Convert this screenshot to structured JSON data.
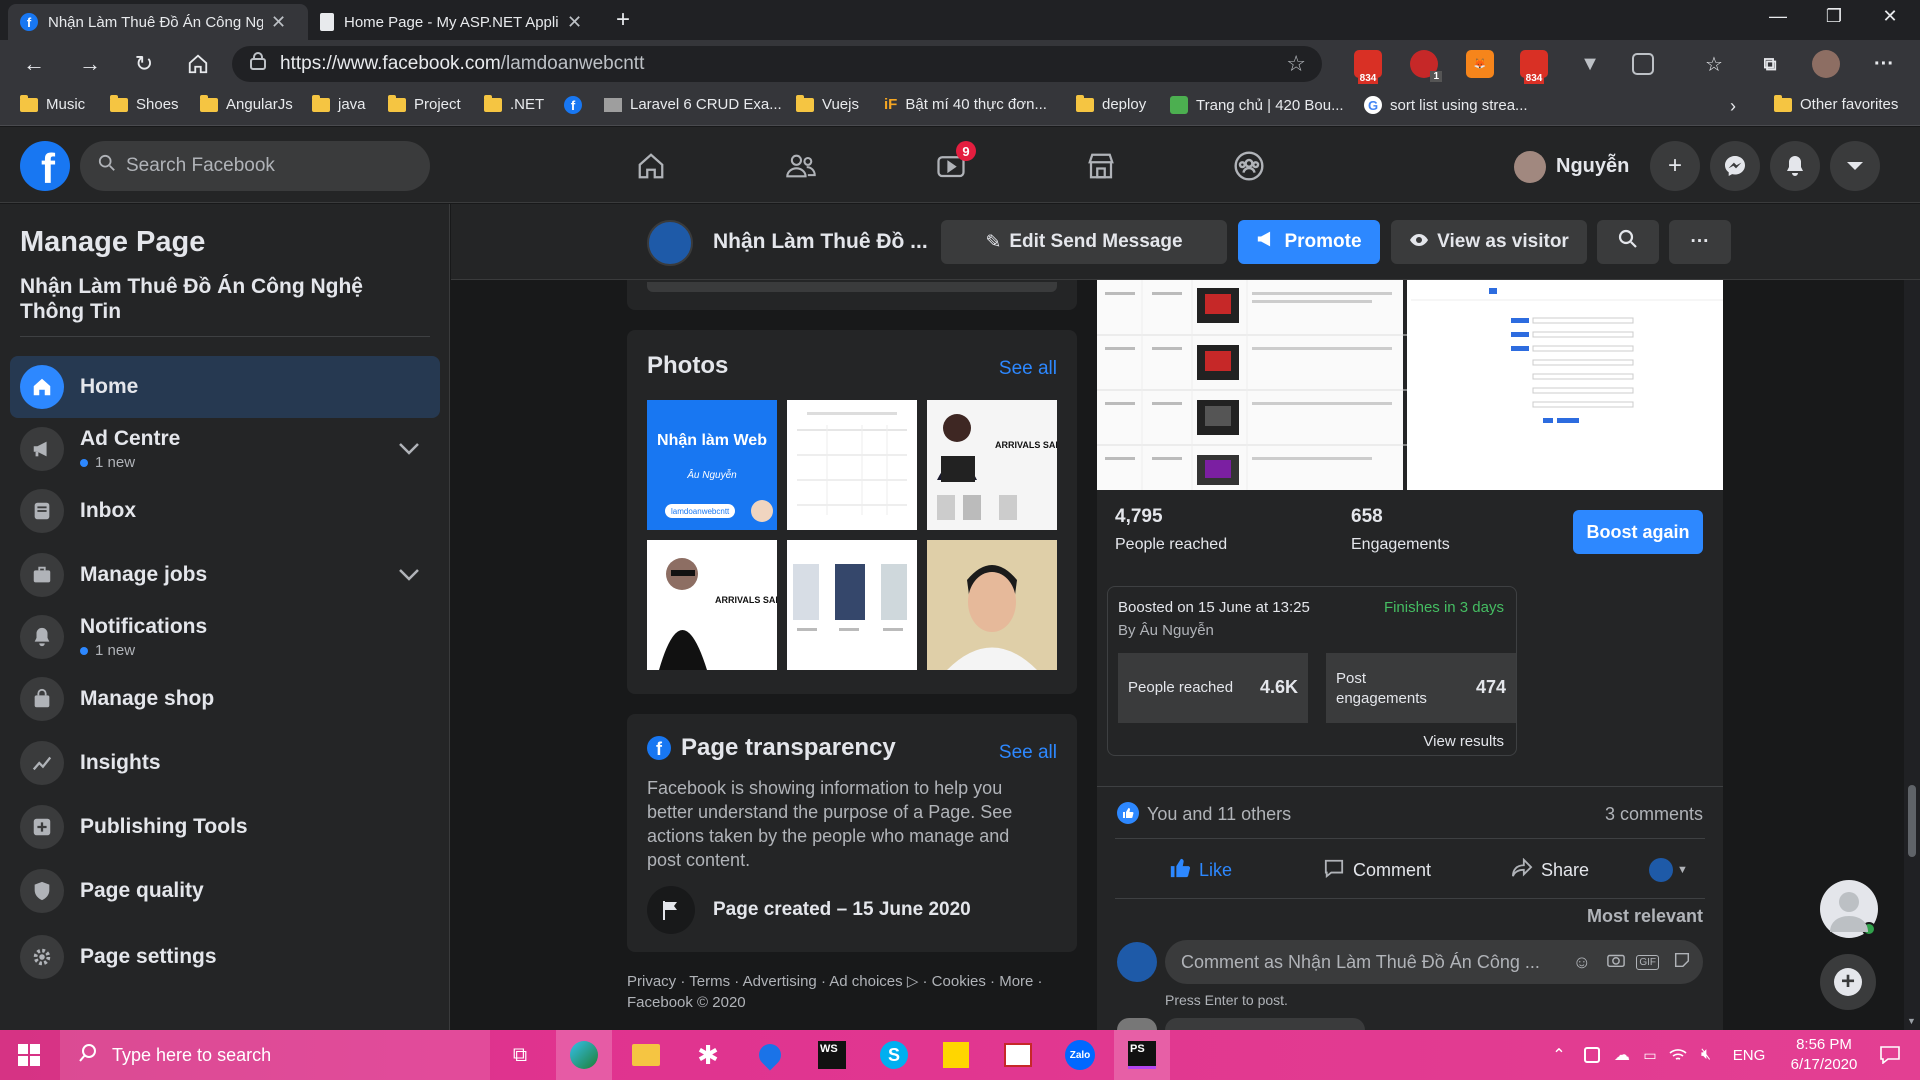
{
  "browser": {
    "tabs": [
      {
        "title": "Nhận Làm Thuê Đồ Án Công Nghệ",
        "active": true
      },
      {
        "title": "Home Page - My ASP.NET Applic",
        "active": false
      }
    ],
    "url_scheme": "https://",
    "url_host": "www.facebook.com",
    "url_path": "/lamdoanwebcntt",
    "ext_badge_1": "834",
    "ext_badge_2": "1",
    "ext_badge_3": "834",
    "bookmarks": [
      "Music",
      "Shoes",
      "AngularJs",
      "java",
      "Project",
      ".NET",
      "",
      "Laravel 6 CRUD Exa...",
      "Vuejs",
      "Bật mí 40 thực đơn...",
      "deploy",
      "Trang chủ | 420 Bou...",
      "sort list using strea..."
    ],
    "other_favorites": "Other favorites"
  },
  "fb_header": {
    "logo": "f",
    "search_placeholder": "Search Facebook",
    "watch_badge": "9",
    "user_name": "Nguyễn"
  },
  "sidebar": {
    "title": "Manage Page",
    "page_name": "Nhận Làm Thuê Đồ Án Công Nghệ Thông Tin",
    "items": [
      {
        "label": "Home",
        "sub": ""
      },
      {
        "label": "Ad Centre",
        "sub": "1 new"
      },
      {
        "label": "Inbox",
        "sub": ""
      },
      {
        "label": "Manage jobs",
        "sub": ""
      },
      {
        "label": "Notifications",
        "sub": "1 new"
      },
      {
        "label": "Manage shop",
        "sub": ""
      },
      {
        "label": "Insights",
        "sub": ""
      },
      {
        "label": "Publishing Tools",
        "sub": ""
      },
      {
        "label": "Page quality",
        "sub": ""
      },
      {
        "label": "Page settings",
        "sub": ""
      }
    ]
  },
  "page_header": {
    "name": "Nhận Làm Thuê Đồ ...",
    "edit_send": "Edit Send Message",
    "promote": "Promote",
    "view_visitor": "View as visitor"
  },
  "photos": {
    "title": "Photos",
    "see_all": "See all",
    "p1_title": "Nhận làm Web",
    "p1_sub": "Âu Nguyễn",
    "p1_handle": "lamdoanwebcntt",
    "arrivals": "ARRIVALS SALE"
  },
  "transparency": {
    "title": "Page transparency",
    "see_all": "See all",
    "body": "Facebook is showing information to help you better understand the purpose of a Page. See actions taken by the people who manage and post content.",
    "created": "Page created – 15 June 2020"
  },
  "footer": {
    "line1": "Privacy · Terms · Advertising · Ad choices ▷ · Cookies · More ·",
    "line2": "Facebook © 2020"
  },
  "post": {
    "reached_value": "4,795",
    "reached_label": "People reached",
    "engagements_value": "658",
    "engagements_label": "Engagements",
    "boost_again": "Boost again",
    "boosted_on": "Boosted on 15 June at 13:25",
    "finishes": "Finishes in 3 days",
    "by": "By Âu Nguyễn",
    "stat1_label": "People reached",
    "stat1_value": "4.6K",
    "stat2_label": "Post engagements",
    "stat2_value": "474",
    "view_results": "View results",
    "reactions": "You and 11 others",
    "comments": "3 comments",
    "like": "Like",
    "comment": "Comment",
    "share": "Share",
    "most_relevant": "Most relevant",
    "comment_placeholder": "Comment as Nhận Làm Thuê Đồ Án Công ...",
    "press_enter": "Press Enter to post."
  },
  "taskbar": {
    "search_placeholder": "Type here to search",
    "lang": "ENG",
    "time": "8:56 PM",
    "date": "6/17/2020"
  },
  "colors": {
    "accent": "#2d88ff",
    "fb_blue": "#1877f2",
    "green": "#45bd62",
    "taskbar": "#e0338f"
  }
}
